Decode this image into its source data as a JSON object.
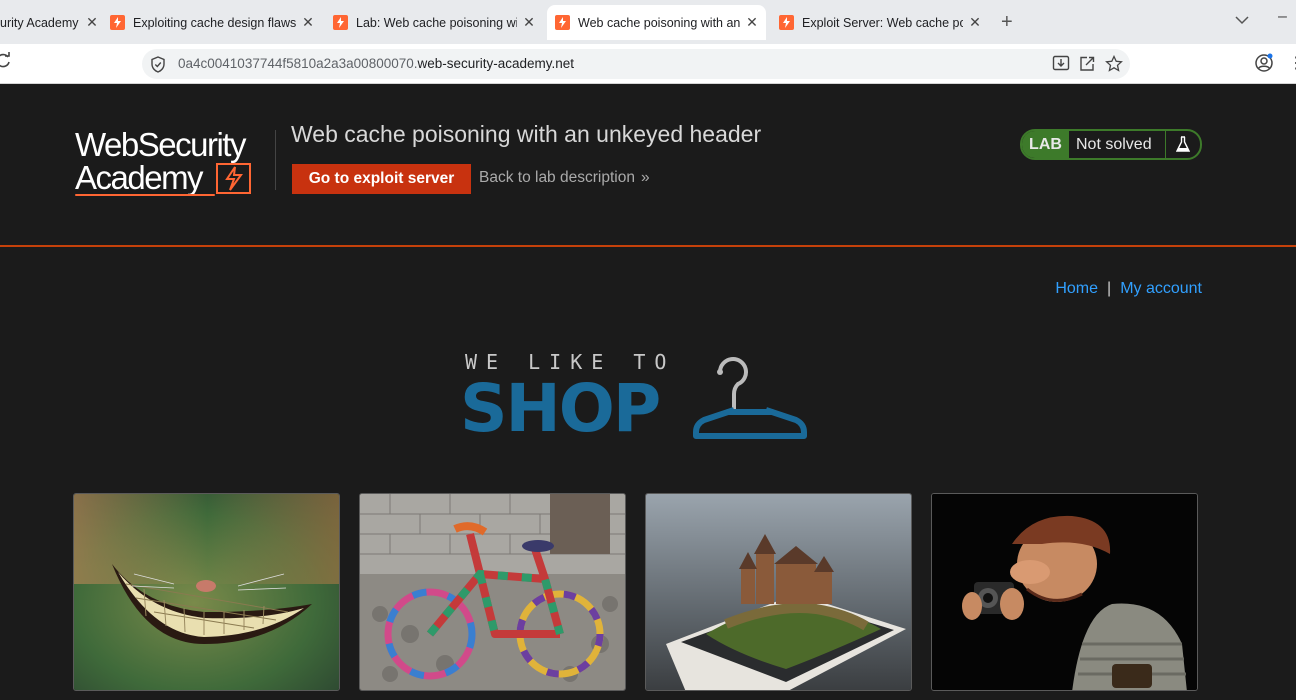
{
  "browser": {
    "tabs": [
      {
        "title": "urity Academy",
        "favicon": false,
        "active": false
      },
      {
        "title": "Exploiting cache design flaws | W",
        "favicon": true,
        "active": false
      },
      {
        "title": "Lab: Web cache poisoning with",
        "favicon": true,
        "active": false
      },
      {
        "title": "Web cache poisoning with an un",
        "favicon": true,
        "active": true
      },
      {
        "title": "Exploit Server: Web cache poiso",
        "favicon": true,
        "active": false
      }
    ],
    "new_tab_label": "+",
    "url_host_prefix": "0a4c0041037744f5810a2a3a00800070.",
    "url_host_domain": "web-security-academy.net"
  },
  "header": {
    "logo_line1": "WebSecurity",
    "logo_line2": "Academy",
    "lab_title": "Web cache poisoning with an unkeyed header",
    "exploit_button": "Go to exploit server",
    "back_link": "Back to lab description",
    "back_chevron": "»",
    "lab_badge": "LAB",
    "lab_status": "Not solved"
  },
  "shop": {
    "nav": {
      "home": "Home",
      "separator": "|",
      "account": "My account"
    },
    "banner_line1": "WE LIKE TO",
    "banner_line2": "SHOP",
    "products": [
      {
        "image": "cheshire-grin-image"
      },
      {
        "image": "knitted-bicycle-image"
      },
      {
        "image": "castle-phone-image"
      },
      {
        "image": "photographer-figurine-image"
      }
    ]
  },
  "colors": {
    "accent_orange": "#c6410a",
    "button_red": "#c8320f",
    "link_blue": "#31a0ff",
    "lab_green": "#3d7a2a",
    "shop_blue": "#1a6a99",
    "background": "#1b1b1b"
  }
}
